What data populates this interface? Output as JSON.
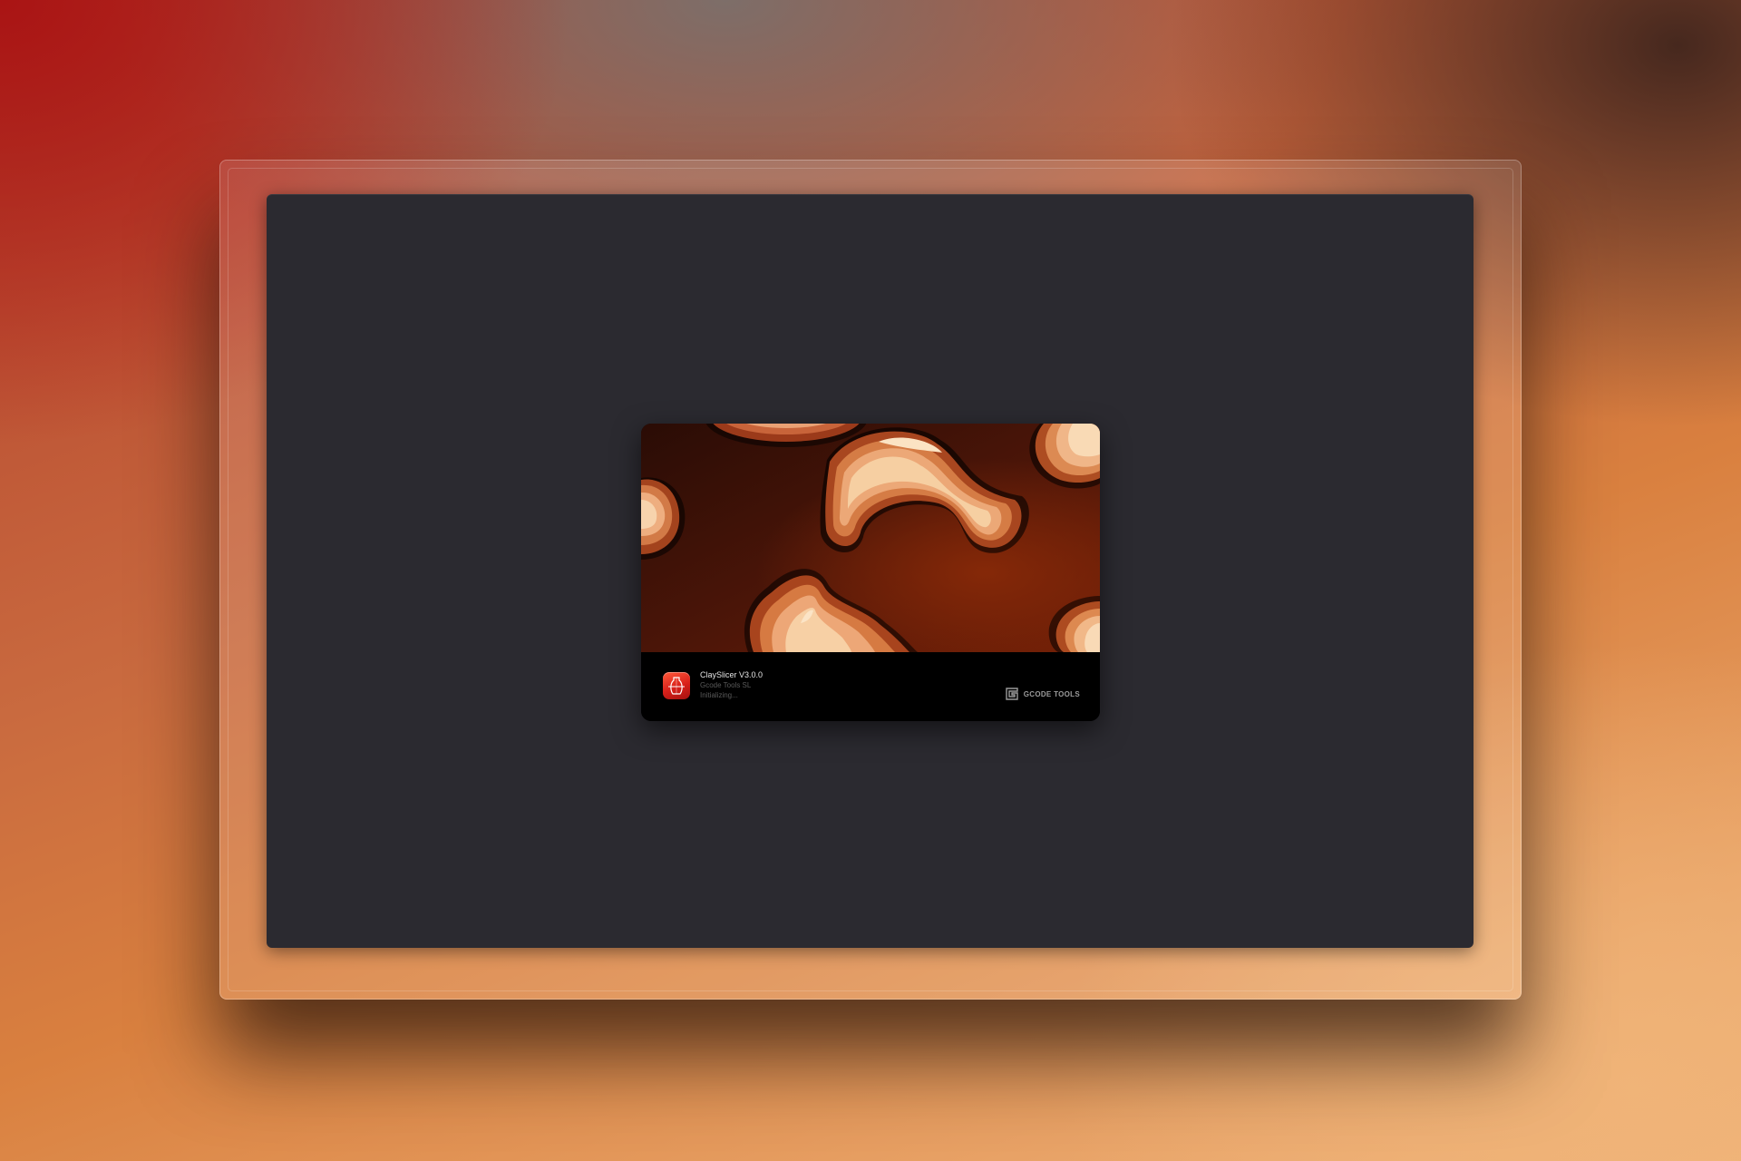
{
  "splash": {
    "app_name": "ClaySlicer V3.0.0",
    "vendor": "Gcode Tools SL",
    "status": "Initializing...",
    "brand_name": "GCODE TOOLS"
  },
  "icons": {
    "app": "clayslicer-vase-icon",
    "brand": "gcode-tools-logo-icon"
  },
  "colors": {
    "window_bg": "#2b2a30",
    "splash_footer_bg": "#000000",
    "app_icon_accent": "#e0261c"
  }
}
